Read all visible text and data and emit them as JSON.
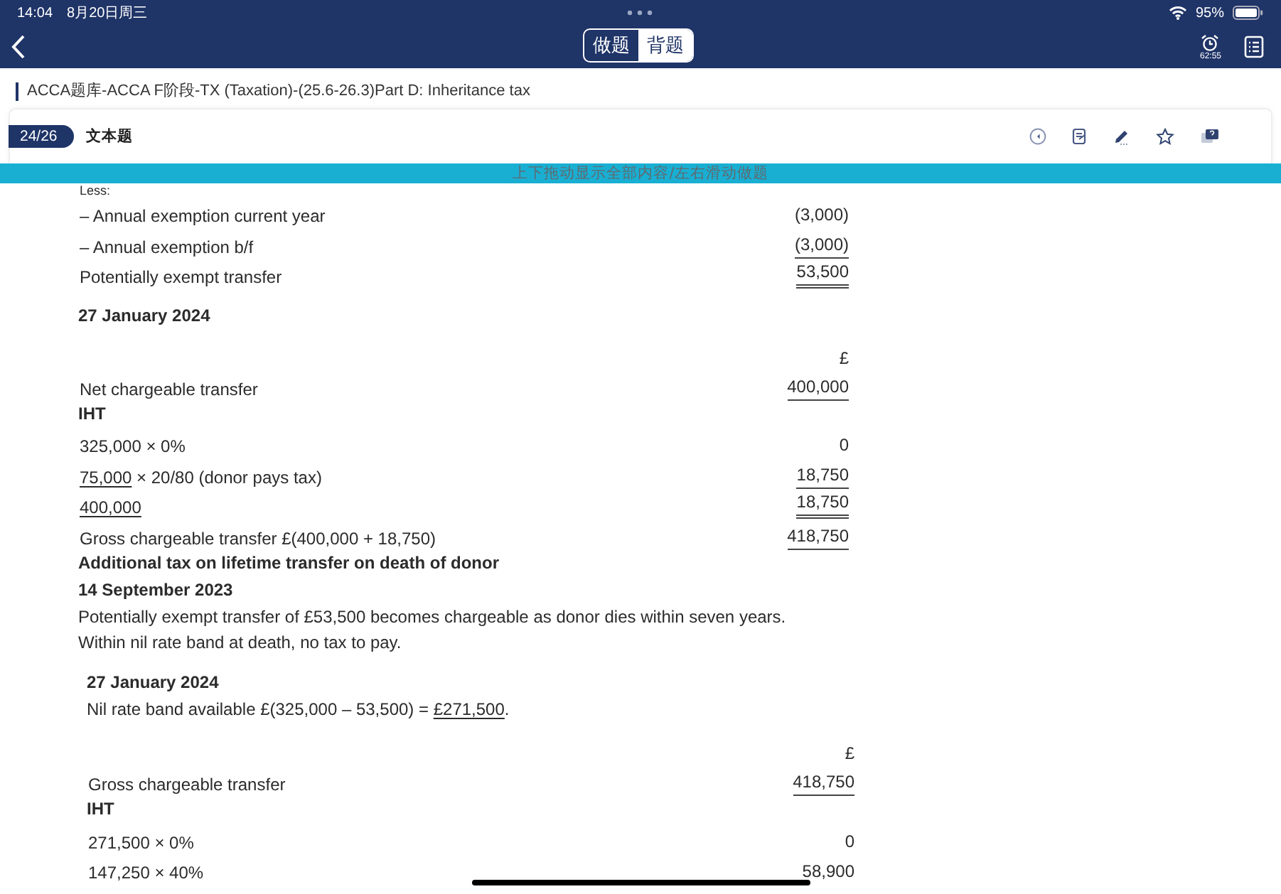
{
  "status_bar": {
    "time": "14:04",
    "date": "8月20日周三",
    "battery": "95%"
  },
  "nav": {
    "tabs": [
      {
        "label": "做题",
        "selected": false
      },
      {
        "label": "背题",
        "selected": true
      }
    ],
    "timer": "62:55"
  },
  "breadcrumb": "ACCA题库-ACCA F阶段-TX (Taxation)-(25.6-26.3)Part D: Inheritance tax",
  "question": {
    "counter": "24/26",
    "type": "文本题"
  },
  "banner": "上下拖动显示全部内容/左右滑动做题",
  "sections": [
    {
      "items": [
        {
          "kind": "row",
          "label": "Less:"
        },
        {
          "kind": "row",
          "label": "– Annual exemption current year",
          "amount": "(3,000)",
          "underlined": false
        },
        {
          "kind": "row",
          "label": "– Annual exemption b/f",
          "amount": "(3,000)",
          "underlined": true,
          "double": false
        },
        {
          "kind": "row",
          "label": "Potentially exempt transfer",
          "amount": "53,500",
          "underlined": true,
          "double": true
        },
        {
          "kind": "date",
          "text": "27 January 2024"
        },
        {
          "kind": "currency",
          "amount": "£"
        },
        {
          "kind": "row",
          "label": "Net chargeable transfer",
          "amount": "400,000",
          "underlined": true,
          "double": false
        },
        {
          "kind": "heading",
          "text": "IHT"
        },
        {
          "kind": "row",
          "label": "325,000 × 0%",
          "amount": "0",
          "underlined": false
        },
        {
          "kind": "row",
          "parts": [
            {
              "text": "75,000",
              "underline": true
            },
            {
              "text": " × 20/80 (donor pays tax)",
              "underline": false
            }
          ],
          "amount": "18,750",
          "underlined": true,
          "double": false
        },
        {
          "kind": "row",
          "parts": [
            {
              "text": "400,000",
              "underline": true
            }
          ],
          "amount": "18,750",
          "underlined": true,
          "double": true
        },
        {
          "kind": "row",
          "label": "Gross chargeable transfer £(400,000 + 18,750)",
          "amount": "418,750",
          "underlined": true,
          "double": false
        },
        {
          "kind": "heading",
          "text": "Additional tax on lifetime transfer on death of donor"
        },
        {
          "kind": "heading",
          "text": "14 September 2023"
        },
        {
          "kind": "para",
          "text": "Potentially exempt transfer of £53,500 becomes chargeable as donor dies within seven years."
        },
        {
          "kind": "para",
          "text": "Within nil rate band at death, no tax to pay."
        }
      ]
    },
    {
      "items": [
        {
          "kind": "date",
          "text": "27 January 2024"
        },
        {
          "kind": "para",
          "parts": [
            {
              "text": "Nil rate band available £(325,000 – 53,500) = ",
              "underline": false
            },
            {
              "text": "£271,500",
              "underline": true
            },
            {
              "text": ".",
              "underline": false
            }
          ]
        },
        {
          "kind": "currency",
          "amount": "£"
        },
        {
          "kind": "row",
          "label": "Gross chargeable transfer",
          "amount": "418,750",
          "underlined": true,
          "double": false
        },
        {
          "kind": "heading",
          "text": "IHT"
        },
        {
          "kind": "row",
          "label": "271,500 × 0%",
          "amount": "0",
          "underlined": false
        },
        {
          "kind": "row",
          "label": "147,250 × 40%",
          "amount": "58,900",
          "underlined": false
        }
      ]
    }
  ]
}
